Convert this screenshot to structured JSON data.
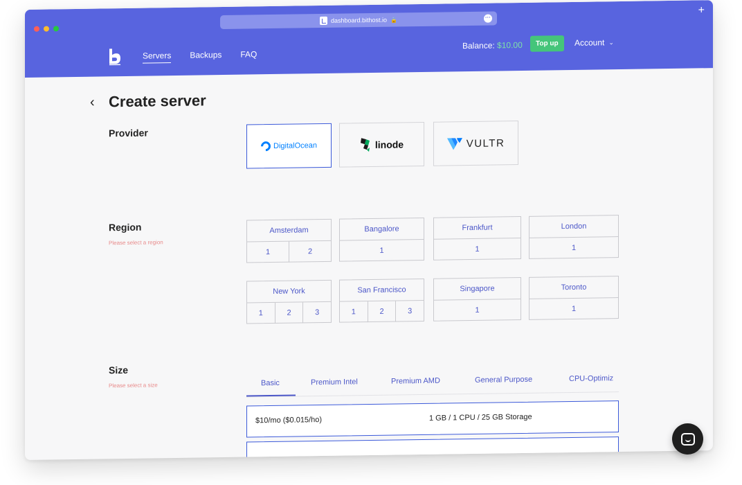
{
  "browser": {
    "url": "dashboard.bithost.io"
  },
  "nav": {
    "items": [
      {
        "label": "Servers",
        "active": true
      },
      {
        "label": "Backups",
        "active": false
      },
      {
        "label": "FAQ",
        "active": false
      }
    ]
  },
  "account": {
    "balance_label": "Balance:",
    "balance_amount": "$10.00",
    "topup_label": "Top up",
    "account_label": "Account"
  },
  "page": {
    "title": "Create server"
  },
  "provider": {
    "label": "Provider",
    "options": [
      {
        "name": "DigitalOcean",
        "selected": true
      },
      {
        "name": "linode",
        "selected": false
      },
      {
        "name": "VULTR",
        "selected": false
      }
    ]
  },
  "region": {
    "label": "Region",
    "error": "Please select a region",
    "options": [
      {
        "name": "Amsterdam",
        "numbers": [
          "1",
          "2"
        ]
      },
      {
        "name": "Bangalore",
        "numbers": [
          "1"
        ]
      },
      {
        "name": "Frankfurt",
        "numbers": [
          "1"
        ]
      },
      {
        "name": "London",
        "numbers": [
          "1"
        ]
      },
      {
        "name": "New York",
        "numbers": [
          "1",
          "2",
          "3"
        ]
      },
      {
        "name": "San Francisco",
        "numbers": [
          "1",
          "2",
          "3"
        ]
      },
      {
        "name": "Singapore",
        "numbers": [
          "1"
        ]
      },
      {
        "name": "Toronto",
        "numbers": [
          "1"
        ]
      }
    ]
  },
  "size": {
    "label": "Size",
    "error": "Please select a size",
    "tabs": [
      {
        "label": "Basic",
        "active": true
      },
      {
        "label": "Premium Intel",
        "active": false
      },
      {
        "label": "Premium AMD",
        "active": false
      },
      {
        "label": "General Purpose",
        "active": false
      },
      {
        "label": "CPU-Optimiz",
        "active": false
      }
    ],
    "options": [
      {
        "price": "$10/mo ($0.015/ho)",
        "spec": "1 GB / 1 CPU / 25 GB Storage"
      }
    ]
  },
  "colors": {
    "header": "#5864df",
    "accent": "#4c57c8",
    "topup": "#45c57a",
    "error": "#e88b8b"
  }
}
